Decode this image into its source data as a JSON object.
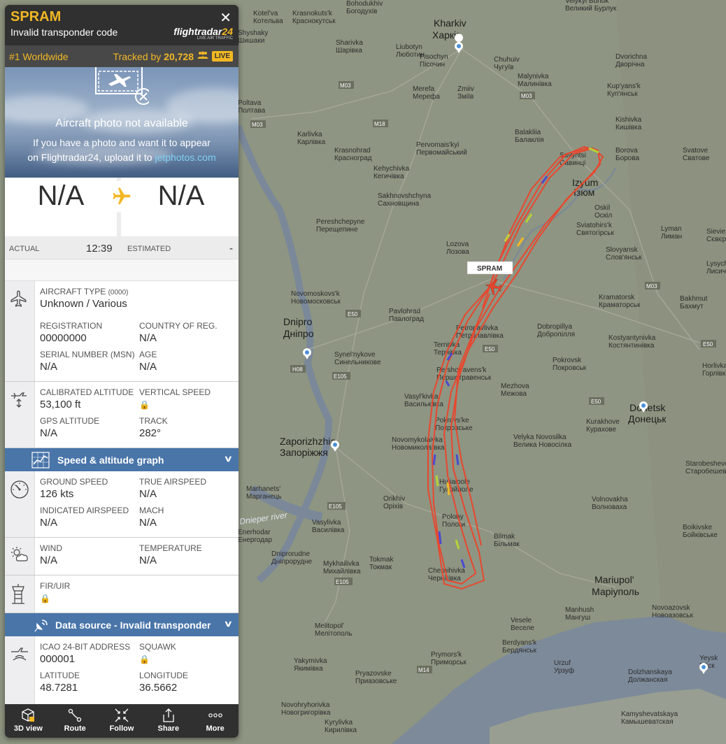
{
  "flight": {
    "callsign": "SPRAM",
    "subtitle": "Invalid transponder code",
    "close": "✕"
  },
  "logo": {
    "main": "flightradar",
    "num": "24",
    "tagline": "LIVE AIR TRAFFIC"
  },
  "rank": {
    "worldwide": "#1 Worldwide",
    "tracked_label": "Tracked by",
    "tracked_count": "20,728",
    "live": "LIVE"
  },
  "photo": {
    "title": "Aircraft photo not available",
    "line1": "If you have a photo and want it to appear",
    "line2_prefix": "on Flightradar24, upload it to ",
    "link": "jetphotos.com"
  },
  "route": {
    "from": "N/A",
    "to": "N/A",
    "actual_label": "ACTUAL",
    "actual_time": "12:39",
    "estimated_label": "ESTIMATED",
    "estimated_time": "-"
  },
  "aircraft": {
    "type_label": "AIRCRAFT TYPE",
    "type_code": "(0000)",
    "type_value": "Unknown / Various",
    "registration_label": "REGISTRATION",
    "registration": "00000000",
    "country_label": "COUNTRY OF REG.",
    "country": "N/A",
    "serial_label": "SERIAL NUMBER (MSN)",
    "serial": "N/A",
    "age_label": "AGE",
    "age": "N/A"
  },
  "altitude": {
    "cal_label": "CALIBRATED ALTITUDE",
    "cal_value": "53,100 ft",
    "vs_label": "VERTICAL SPEED",
    "gps_label": "GPS ALTITUDE",
    "gps_value": "N/A",
    "track_label": "TRACK",
    "track_value": "282°"
  },
  "graph_bar": {
    "label": "Speed & altitude graph"
  },
  "speed": {
    "gs_label": "GROUND SPEED",
    "gs_value": "126 kts",
    "tas_label": "TRUE AIRSPEED",
    "tas_value": "N/A",
    "ias_label": "INDICATED AIRSPEED",
    "ias_value": "N/A",
    "mach_label": "MACH",
    "mach_value": "N/A"
  },
  "weather": {
    "wind_label": "WIND",
    "wind_value": "N/A",
    "temp_label": "TEMPERATURE",
    "temp_value": "N/A"
  },
  "fir": {
    "label": "FIR/UIR"
  },
  "source_bar": {
    "label": "Data source - Invalid transponder"
  },
  "source": {
    "icao_label": "ICAO 24-BIT ADDRESS",
    "icao_value": "000001",
    "squawk_label": "SQUAWK",
    "lat_label": "LATITUDE",
    "lat_value": "48.7281",
    "lon_label": "LONGITUDE",
    "lon_value": "36.5662"
  },
  "toolbar": {
    "view3d": "3D view",
    "route": "Route",
    "follow": "Follow",
    "share": "Share",
    "more": "More"
  },
  "map": {
    "plane_label": "SPRAM",
    "cities_big": [
      {
        "en": "Kharkiv",
        "uk": "Харків"
      },
      {
        "en": "Dnipro",
        "uk": "Дніпро"
      },
      {
        "en": "Zaporizhzhia",
        "uk": "Запоріжжя"
      },
      {
        "en": "Mariupol'",
        "uk": "Маріуполь"
      },
      {
        "en": "Donetsk",
        "uk": "Донецьк"
      },
      {
        "en": "Izyum",
        "uk": "Ізюм"
      }
    ],
    "cities_small": [
      {
        "en": "Kotel'va",
        "uk": "Котельва"
      },
      {
        "en": "Krasnokuts'k",
        "uk": "Краснокутськ"
      },
      {
        "en": "Bohodukhiv",
        "uk": "Богодухів"
      },
      {
        "en": "Velykyi Burluk",
        "uk": "Великий Бурлук"
      },
      {
        "en": "Shyshaky",
        "uk": "Шишаки"
      },
      {
        "en": "Sharivka",
        "uk": "Шарівка"
      },
      {
        "en": "Liubotyn",
        "uk": "Люботин"
      },
      {
        "en": "Pisochyn",
        "uk": "Пісочин"
      },
      {
        "en": "Chuhuiv",
        "uk": "Чугуїв"
      },
      {
        "en": "Dvorichna",
        "uk": "Дворічна"
      },
      {
        "en": "Malynivka",
        "uk": "Малинівка"
      },
      {
        "en": "Merefa",
        "uk": "Мерефа"
      },
      {
        "en": "Zmiiv",
        "uk": "Зміїв"
      },
      {
        "en": "Kup'yans'k",
        "uk": "Куп'янськ"
      },
      {
        "en": "Poltava",
        "uk": "Полтава"
      },
      {
        "en": "Kishivka",
        "uk": "Кишівка"
      },
      {
        "en": "Karlivka",
        "uk": "Карлівка"
      },
      {
        "en": "Pervomais'kyi",
        "uk": "Первомайський"
      },
      {
        "en": "Balakliia",
        "uk": "Балаклія"
      },
      {
        "en": "Krasnohrad",
        "uk": "Красноград"
      },
      {
        "en": "Savyntsi",
        "uk": "Савинці"
      },
      {
        "en": "Borova",
        "uk": "Борова"
      },
      {
        "en": "Svatove",
        "uk": "Сватове"
      },
      {
        "en": "Kehychivka",
        "uk": "Кегичівка"
      },
      {
        "en": "Sakhnovshchyna",
        "uk": "Сахновщина"
      },
      {
        "en": "Oskil",
        "uk": "Оскіл"
      },
      {
        "en": "Lyman",
        "uk": "Лиман"
      },
      {
        "en": "Pereshchepyne",
        "uk": "Перещепине"
      },
      {
        "en": "Sviatohirs'k",
        "uk": "Святогірськ"
      },
      {
        "en": "Lozova",
        "uk": "Лозова"
      },
      {
        "en": "Slovyansk",
        "uk": "Слов'янськ"
      },
      {
        "en": "Novomoskovs'k",
        "uk": "Новомосковськ"
      },
      {
        "en": "Pavlohrad",
        "uk": "Павлоград"
      },
      {
        "en": "Kramatorsk",
        "uk": "Краматорськ"
      },
      {
        "en": "Bakhmut",
        "uk": "Бахмут"
      },
      {
        "en": "Petropavlivka",
        "uk": "Петропавлівка"
      },
      {
        "en": "Ternivka",
        "uk": "Тернівка"
      },
      {
        "en": "Dobropillya",
        "uk": "Добропілля"
      },
      {
        "en": "Kostyantynivka",
        "uk": "Костянтинівка"
      },
      {
        "en": "Synel'nykove",
        "uk": "Синельникове"
      },
      {
        "en": "Pershotravens'k",
        "uk": "Першотравенськ"
      },
      {
        "en": "Pokrovsk",
        "uk": "Покровськ"
      },
      {
        "en": "Horlivka",
        "uk": "Горлівка"
      },
      {
        "en": "Mezhova",
        "uk": "Межова"
      },
      {
        "en": "Vasyl'kivka",
        "uk": "Васильківка"
      },
      {
        "en": "Pokrovs'ke",
        "uk": "Покровське"
      },
      {
        "en": "Kurakhove",
        "uk": "Курахове"
      },
      {
        "en": "Novomykolaivka",
        "uk": "Новомиколаївка"
      },
      {
        "en": "Velyka Novosilka",
        "uk": "Велика Новосілка"
      },
      {
        "en": "Starobesheve",
        "uk": "Старобешеве"
      },
      {
        "en": "Marhanets'",
        "uk": "Марганець"
      },
      {
        "en": "Huliaipole",
        "uk": "Гуляйполе"
      },
      {
        "en": "Volnovakha",
        "uk": "Волноваха"
      },
      {
        "en": "Orikhiv",
        "uk": "Оріхів"
      },
      {
        "en": "Vasylivka",
        "uk": "Василівка"
      },
      {
        "en": "Polohy",
        "uk": "Пологи"
      },
      {
        "en": "Boikivske",
        "uk": "Бойківське"
      },
      {
        "en": "Enerhodar",
        "uk": "Енергодар"
      },
      {
        "en": "Bilmak",
        "uk": "Більмак"
      },
      {
        "en": "Dniprorudne",
        "uk": "Дніпрорудне"
      },
      {
        "en": "Tokmak",
        "uk": "Токмак"
      },
      {
        "en": "Mykhailivka",
        "uk": "Михайлівка"
      },
      {
        "en": "Chernihivka",
        "uk": "Чернігівка"
      },
      {
        "en": "Novoazovsk",
        "uk": "Новоазовськ"
      },
      {
        "en": "Manhush",
        "uk": "Мангуш"
      },
      {
        "en": "Vesele",
        "uk": "Веселе"
      },
      {
        "en": "Melitopol'",
        "uk": "Мелітополь"
      },
      {
        "en": "Berdyans'k",
        "uk": "Бердянськ"
      },
      {
        "en": "Urzuf",
        "uk": "Урзуф"
      },
      {
        "en": "Yakymivka",
        "uk": "Якимівка"
      },
      {
        "en": "Prymors'k",
        "uk": "Приморськ"
      },
      {
        "en": "Pryazovske",
        "uk": "Приазовське"
      },
      {
        "en": "Dolzhanskaya",
        "uk": "Должанская"
      },
      {
        "en": "Yeysk",
        "uk": "Ейск"
      },
      {
        "en": "Novohryhorivka",
        "uk": "Новогригорівка"
      },
      {
        "en": "Kyrylivka",
        "uk": "Кирилівка"
      },
      {
        "en": "Kamyshevatskaya",
        "uk": "Камышеватская"
      },
      {
        "en": "Sievierodonetsk",
        "uk": "Сєвєродонецьк"
      },
      {
        "en": "Lysychansk",
        "uk": "Лисичанськ"
      }
    ],
    "roads": [
      "M03",
      "M03",
      "M18",
      "M03",
      "M03",
      "E50",
      "E50",
      "E50",
      "E50",
      "H08",
      "E105",
      "E105",
      "E105",
      "M14"
    ],
    "river": "Dnieper river"
  },
  "colors": {
    "accent": "#f2b824",
    "blue": "#4975a9",
    "dark": "#303030",
    "track": "#e8472f"
  }
}
